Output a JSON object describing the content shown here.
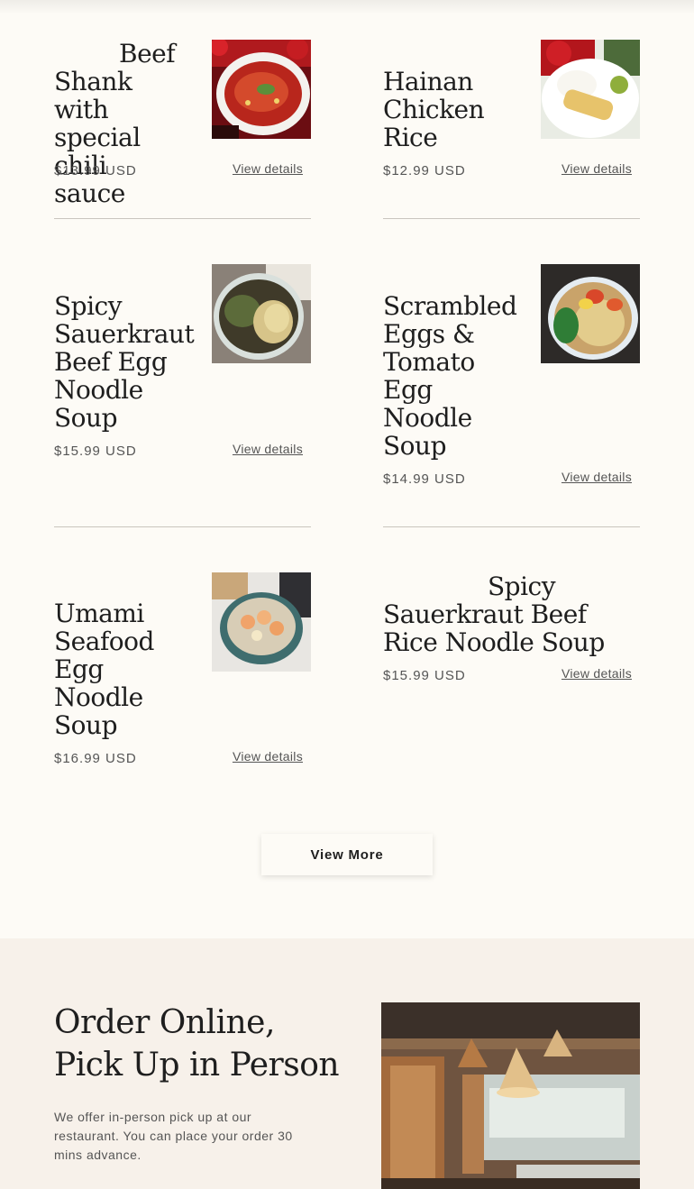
{
  "products": [
    {
      "title": "Beef Shank with special chili sauce",
      "price": "$13.99 USD",
      "details_label": "View details",
      "image": "chili-beef-dish-photo"
    },
    {
      "title": "Hainan Chicken Rice",
      "price": "$12.99 USD",
      "details_label": "View details",
      "image": "chicken-rice-photo"
    },
    {
      "title": "Spicy Sauerkraut Beef Egg Noodle Soup",
      "price": "$15.99 USD",
      "details_label": "View details",
      "image": "beef-noodle-soup-photo"
    },
    {
      "title": "Scrambled Eggs & Tomato Egg Noodle Soup",
      "price": "$14.99 USD",
      "details_label": "View details",
      "image": "tomato-egg-noodle-photo"
    },
    {
      "title": "Umami Seafood Egg Noodle Soup",
      "price": "$16.99 USD",
      "details_label": "View details",
      "image": "seafood-noodle-photo"
    },
    {
      "title": "Spicy Sauerkraut Beef Rice Noodle Soup",
      "price": "$15.99 USD",
      "details_label": "View details"
    }
  ],
  "view_more_label": "View More",
  "order": {
    "title": "Order Online, Pick Up in Person",
    "text": "We offer in-person pick up at our restaurant. You can place your order 30 mins advance.",
    "image": "restaurant-interior-photo"
  }
}
